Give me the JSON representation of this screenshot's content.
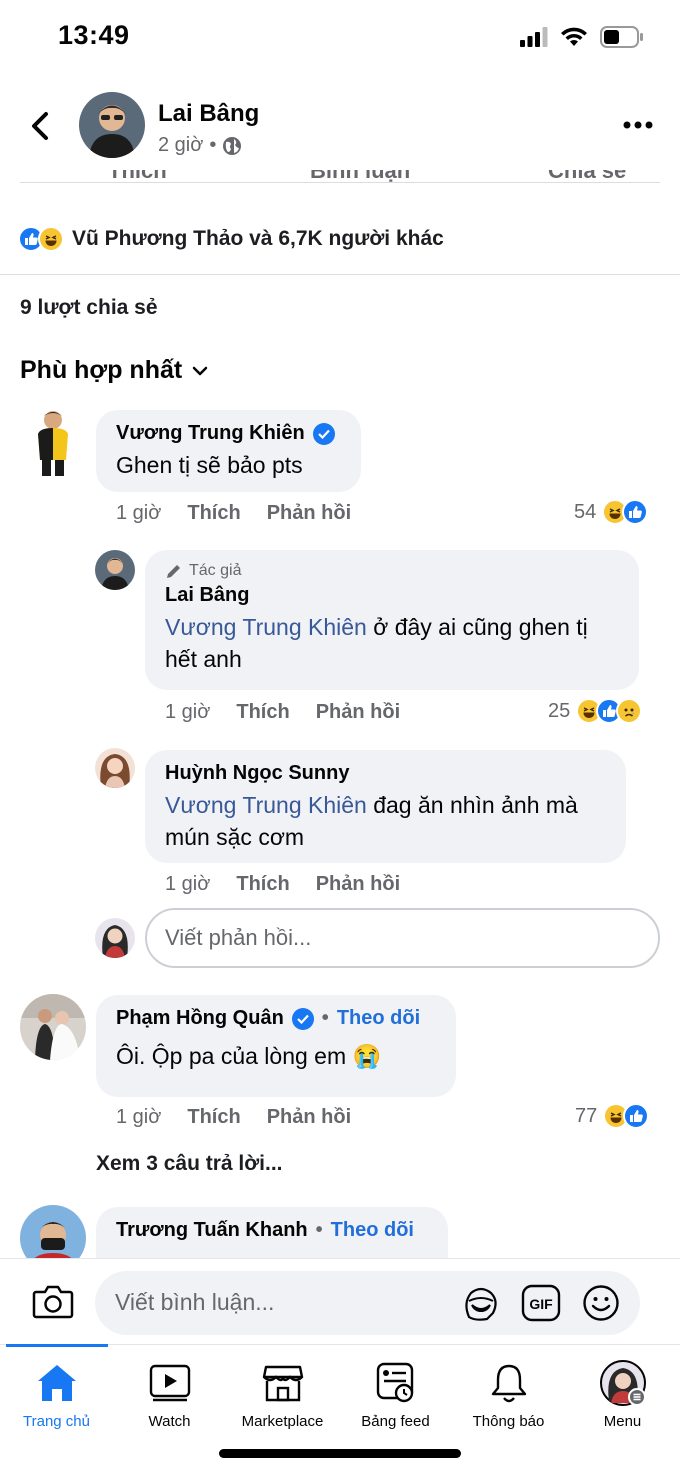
{
  "status_bar": {
    "time": "13:49"
  },
  "header": {
    "author_name": "Lai Bâng",
    "time": "2 giờ",
    "separator": "•"
  },
  "post_actions_cut": [
    "Thích",
    "Bình luận",
    "Chia sẻ"
  ],
  "reactions": {
    "text": "Vũ Phương Thảo và 6,7K người khác"
  },
  "shares": {
    "text": "9 lượt chia sẻ"
  },
  "sort": {
    "label": "Phù hợp nhất"
  },
  "comments": [
    {
      "name": "Vương Trung Khiên",
      "text": "Ghen tị sẽ bảo pts",
      "time": "1 giờ",
      "like_label": "Thích",
      "reply_label": "Phản hồi",
      "reaction_count": "54"
    },
    {
      "author_tag": "Tác giả",
      "name": "Lai Bâng",
      "mention": "Vương Trung Khiên",
      "text": " ở đây ai cũng ghen tị hết anh",
      "time": "1 giờ",
      "like_label": "Thích",
      "reply_label": "Phản hồi",
      "reaction_count": "25"
    },
    {
      "name": "Huỳnh Ngọc Sunny",
      "mention": "Vương Trung Khiên",
      "text": " đag ăn nhìn ảnh mà mún sặc cơm",
      "time": "1 giờ",
      "like_label": "Thích",
      "reply_label": "Phản hồi"
    },
    {
      "name": "Phạm Hồng Quân",
      "follow_label": "Theo dõi",
      "text": "Ôi. Ộp pa của lòng em 😭",
      "time": "1 giờ",
      "like_label": "Thích",
      "reply_label": "Phản hồi",
      "reaction_count": "77"
    },
    {
      "name": "Trương Tuấn Khanh",
      "follow_label": "Theo dõi"
    }
  ],
  "reply_input": {
    "placeholder": "Viết phản hồi..."
  },
  "see_replies": "Xem 3 câu trả lời...",
  "composer": {
    "placeholder": "Viết bình luận..."
  },
  "bottom_nav": [
    {
      "label": "Trang chủ",
      "icon": "home-icon",
      "active": true
    },
    {
      "label": "Watch",
      "icon": "watch-icon"
    },
    {
      "label": "Marketplace",
      "icon": "marketplace-icon"
    },
    {
      "label": "Bảng feed",
      "icon": "feed-icon"
    },
    {
      "label": "Thông báo",
      "icon": "bell-icon"
    },
    {
      "label": "Menu",
      "icon": "menu-avatar"
    }
  ],
  "colors": {
    "accent": "#1877f2",
    "secondary_text": "#65676b",
    "bubble": "#f0f2f5",
    "mention": "#385898"
  }
}
